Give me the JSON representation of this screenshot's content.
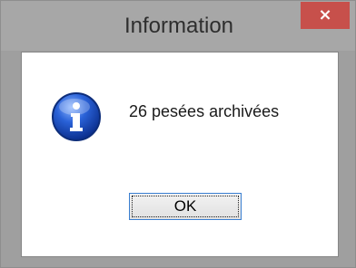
{
  "dialog": {
    "title": "Information",
    "close_label": "×",
    "icon": "info-icon",
    "message": "26 pesées archivées",
    "ok_label": "OK"
  },
  "colors": {
    "titlebar": "#a7a7a7",
    "close_button": "#c7504b",
    "ok_border": "#3a7fd1",
    "content_background": "#ffffff"
  }
}
